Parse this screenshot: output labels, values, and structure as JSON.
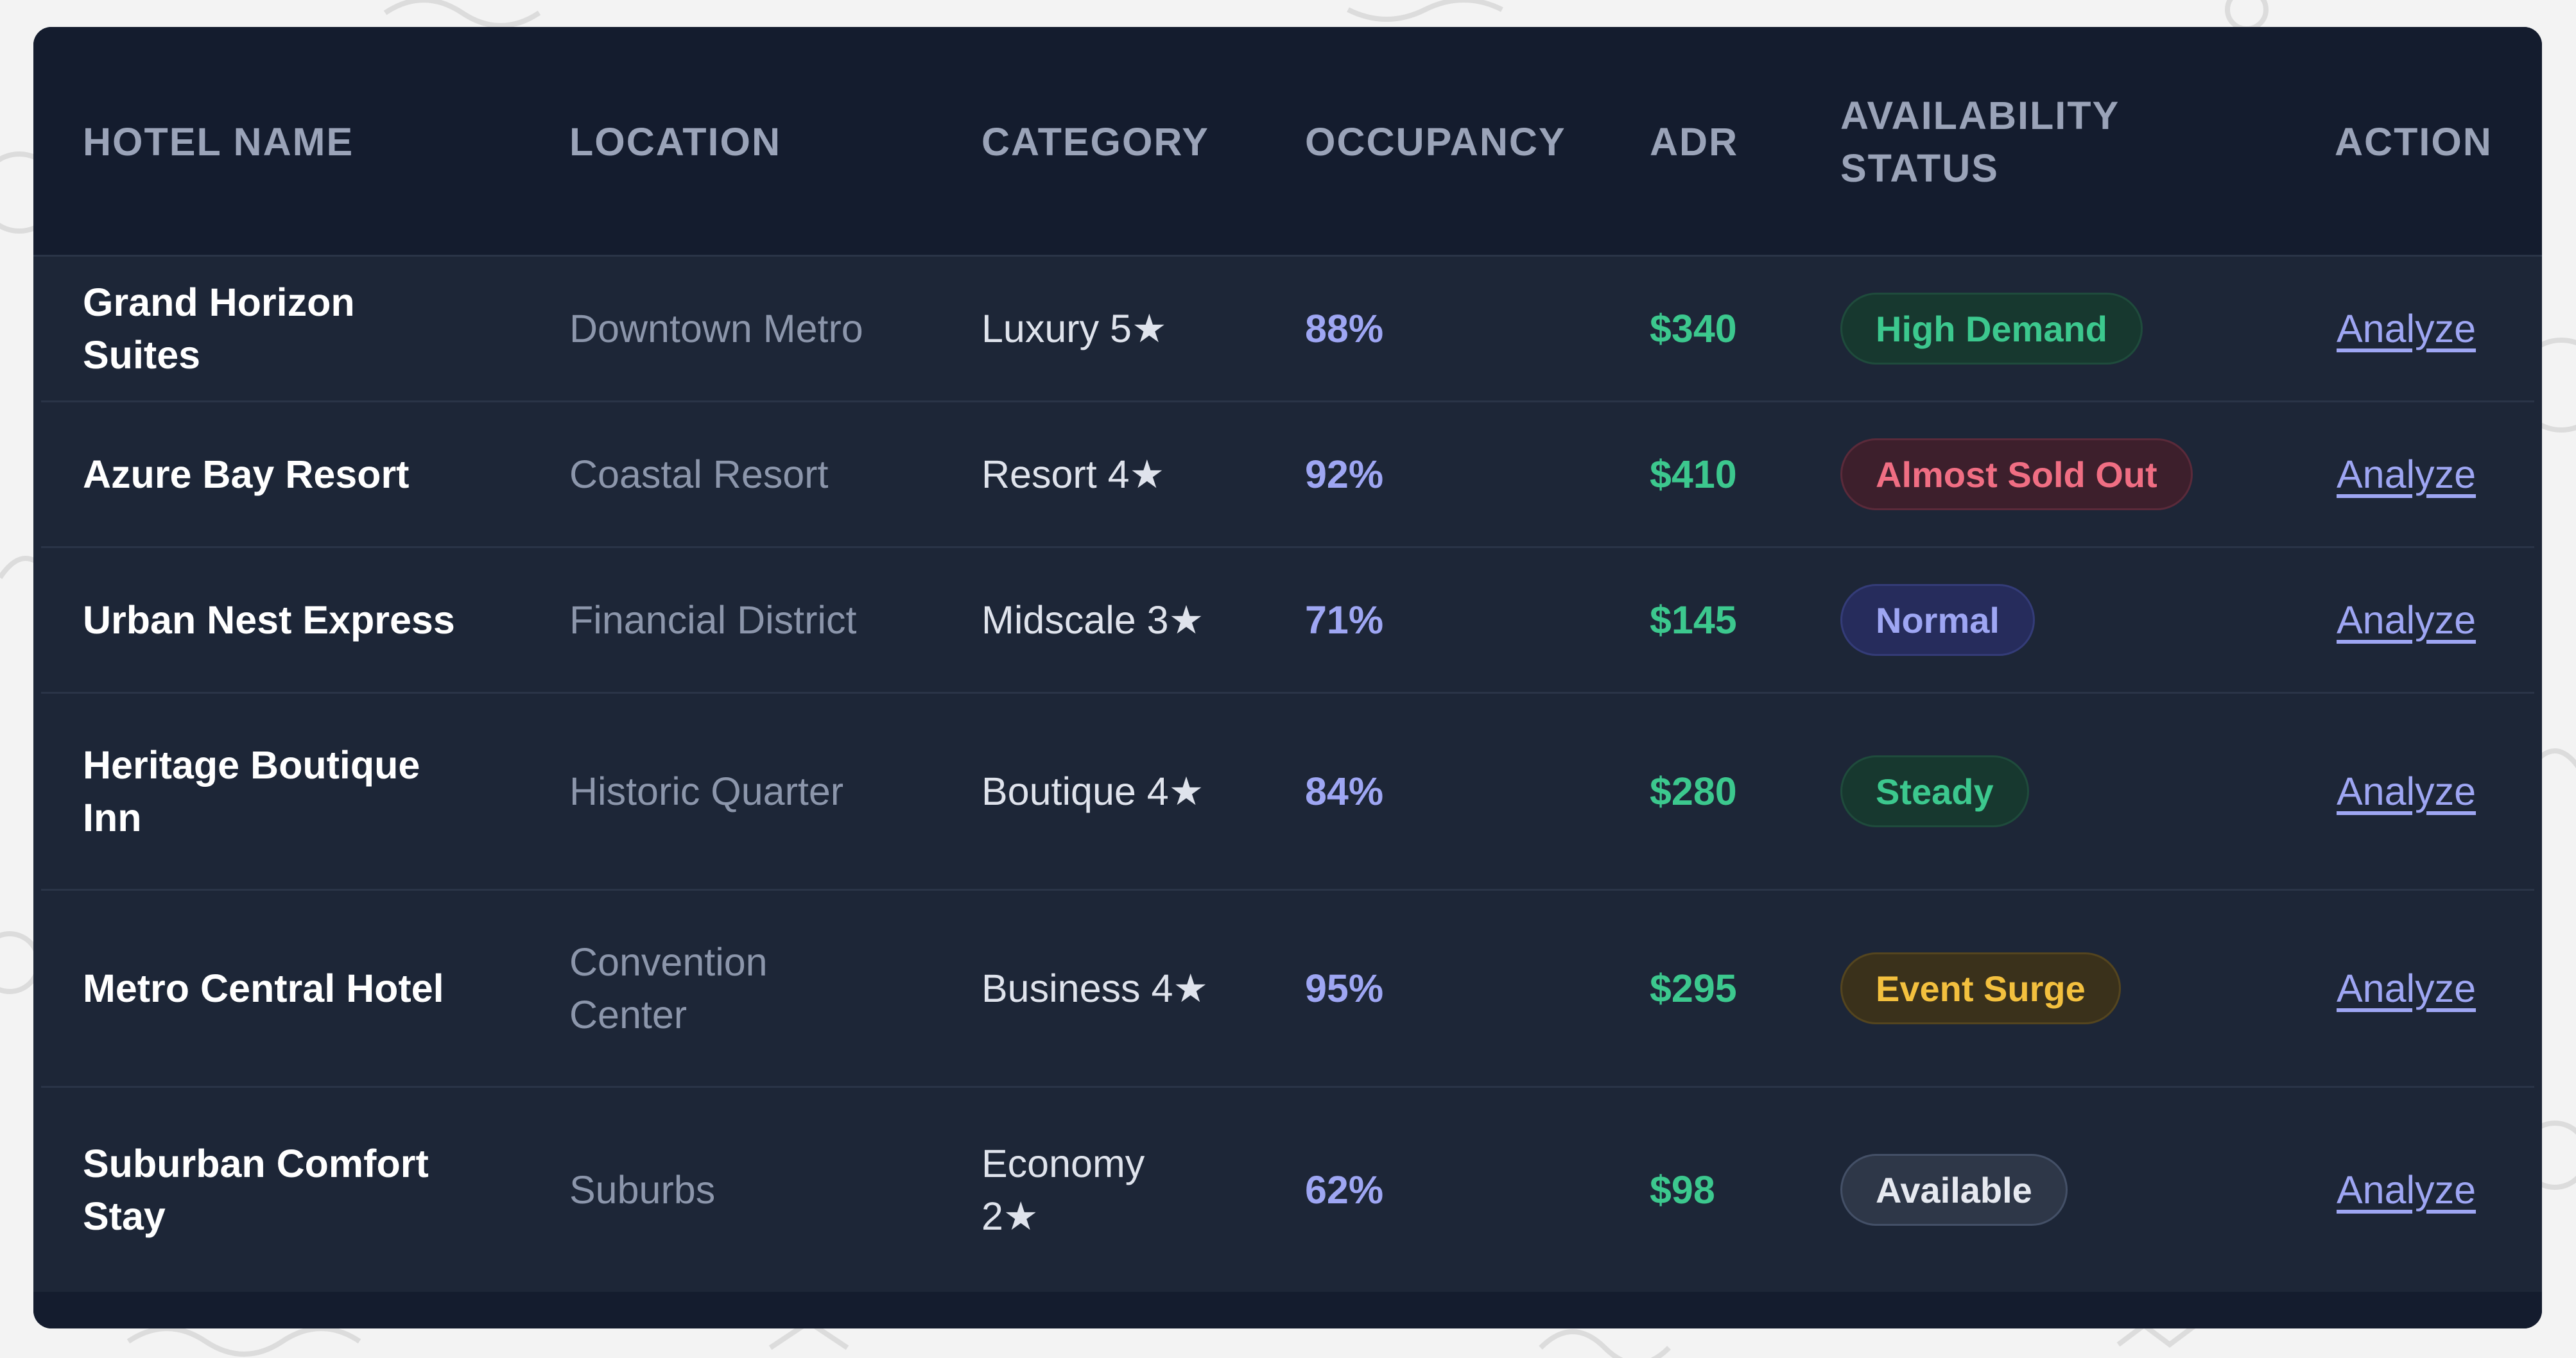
{
  "table": {
    "columns": [
      "HOTEL NAME",
      "LOCATION",
      "CATEGORY",
      "OCCUPANCY",
      "ADR",
      "AVAILABILITY STATUS",
      "ACTION"
    ],
    "rows": [
      {
        "hotel_name": "Grand Horizon Suites",
        "location": "Downtown Metro",
        "category": "Luxury 5★",
        "occupancy": "88%",
        "adr": "$340",
        "status": "High Demand",
        "status_color": "#3cc88e",
        "action": "Analyze"
      },
      {
        "hotel_name": "Azure Bay Resort",
        "location": "Coastal Resort",
        "category": "Resort 4★",
        "occupancy": "92%",
        "adr": "$410",
        "status": "Almost Sold Out",
        "status_color": "#f06e83",
        "action": "Analyze"
      },
      {
        "hotel_name": "Urban Nest Express",
        "location": "Financial District",
        "category": "Midscale 3★",
        "occupancy": "71%",
        "adr": "$145",
        "status": "Normal",
        "status_color": "#9ea6f3",
        "action": "Analyze"
      },
      {
        "hotel_name": "Heritage Boutique Inn",
        "location": "Historic Quarter",
        "category": "Boutique 4★",
        "occupancy": "84%",
        "adr": "$280",
        "status": "Steady",
        "status_color": "#3cc88e",
        "action": "Analyze"
      },
      {
        "hotel_name": "Metro Central Hotel",
        "location": "Convention Center",
        "category": "Business 4★",
        "occupancy": "95%",
        "adr": "$295",
        "status": "Event Surge",
        "status_color": "#f3c03e",
        "action": "Analyze"
      },
      {
        "hotel_name": "Suburban Comfort Stay",
        "location": "Suburbs",
        "category": "Economy 2★",
        "occupancy": "62%",
        "adr": "$98",
        "status": "Available",
        "status_color": "#e6e9f0",
        "action": "Analyze"
      }
    ]
  },
  "colors": {
    "card_bg": "#1d2637",
    "header_bg": "#141c2e",
    "accent_indigo": "#9ea6f3",
    "accent_green": "#3cc88e"
  }
}
